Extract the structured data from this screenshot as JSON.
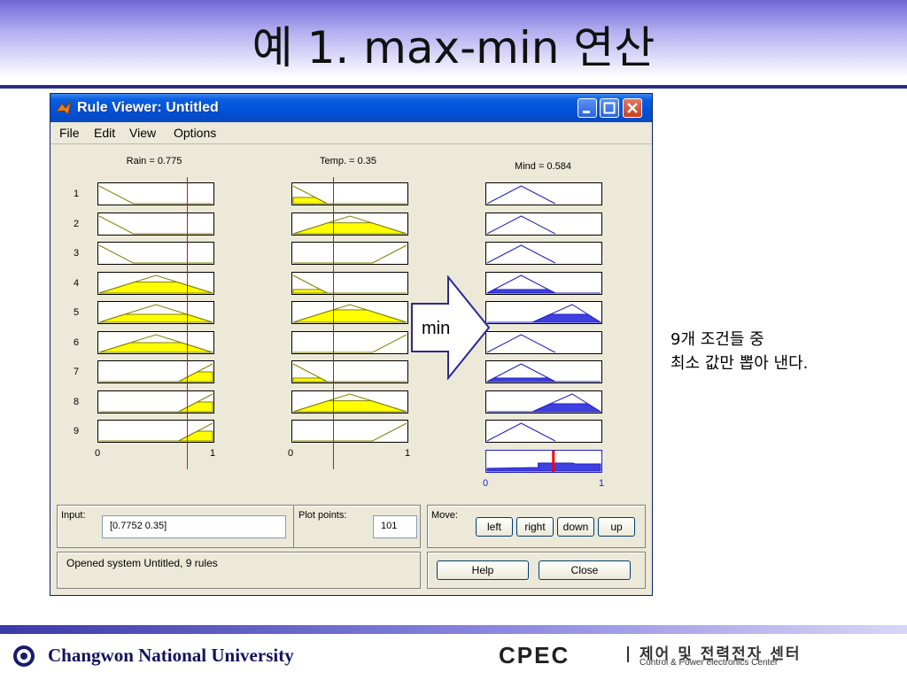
{
  "slide": {
    "title": "예 1. max-min 연산",
    "note_lines": [
      "9개 조건들 중",
      "최소 값만 뽑아 낸다."
    ]
  },
  "window": {
    "title": "Rule Viewer: Untitled",
    "menu": [
      "File",
      "Edit",
      "View",
      "Options"
    ]
  },
  "plots": {
    "rain_header": "Rain = 0.775",
    "temp_header": "Temp. = 0.35",
    "mind_header": "Mind = 0.584",
    "row_numbers": [
      "1",
      "2",
      "3",
      "4",
      "5",
      "6",
      "7",
      "8",
      "9"
    ],
    "tick_zero": "0",
    "tick_one": "1",
    "rain_value": 0.775,
    "temp_value": 0.35,
    "mind_value": 0.584,
    "arrow_label": "min"
  },
  "controls": {
    "input_label": "Input:",
    "input_value": "[0.7752 0.35]",
    "plot_points_label": "Plot points:",
    "plot_points_value": "101",
    "move_label": "Move:",
    "move_buttons": [
      "left",
      "right",
      "down",
      "up"
    ],
    "status": "Opened system Untitled, 9 rules",
    "help_label": "Help",
    "close_label": "Close"
  },
  "footer": {
    "university": "Changwon National University",
    "lab_logo": "CPEC",
    "center_ko": "제어 및 전력전자 센터",
    "center_en": "Control & Power electronics Center"
  },
  "colors": {
    "fill_input": "#ffff00",
    "line_input": "#808000",
    "fill_output": "#4040e0",
    "line_output": "#1f1fc0",
    "value_line": "#ff0000"
  }
}
